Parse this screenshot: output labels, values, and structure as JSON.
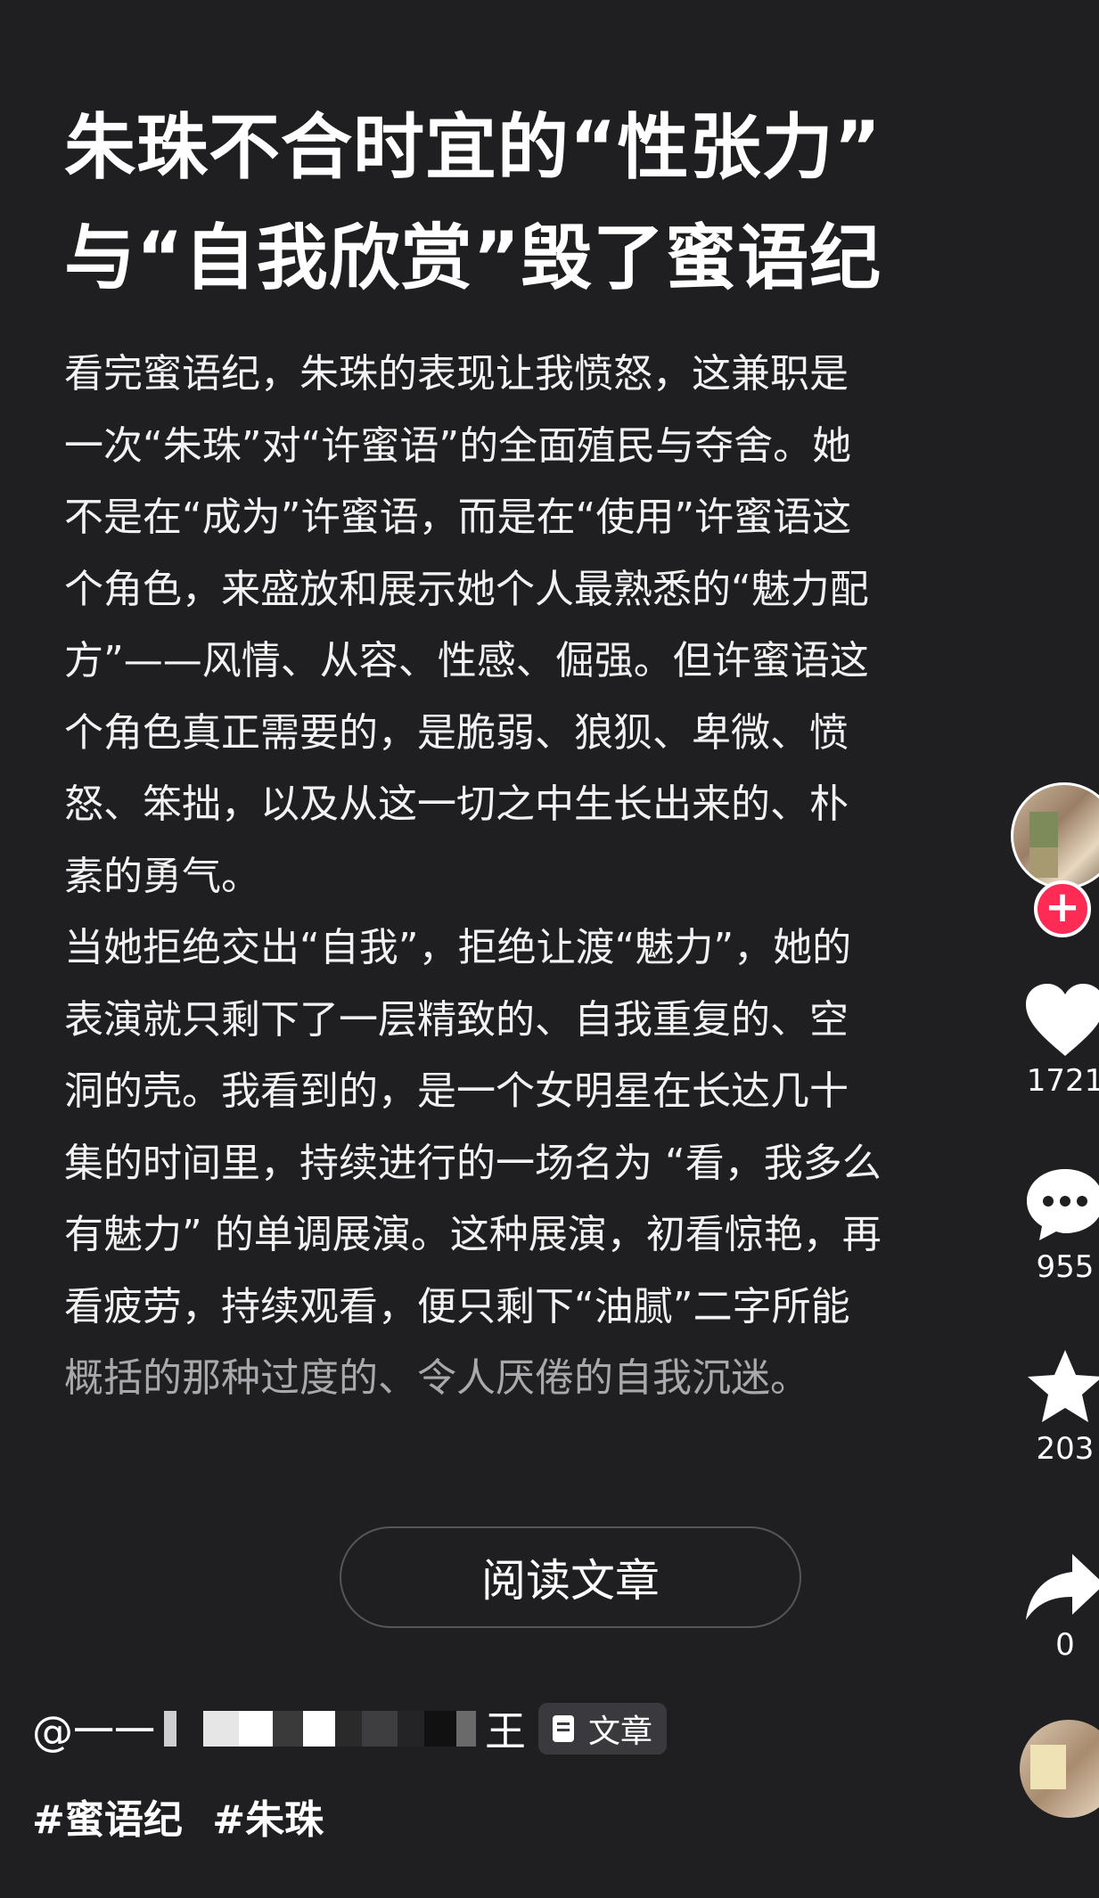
{
  "article": {
    "title_lines": [
      "朱珠不合时宜的“性张力”",
      "与“自我欣赏”毁了蜜语纪"
    ],
    "body_lines": [
      "看完蜜语纪，朱珠的表现让我愤怒，这兼职是",
      "一次“朱珠”对“许蜜语”的全面殖民与夺舍。她",
      "不是在“成为”许蜜语，而是在“使用”许蜜语这",
      "个角色，来盛放和展示她个人最熟悉的“魅力配",
      "方”——风情、从容、性感、倔强。但许蜜语这",
      "个角色真正需要的，是脆弱、狼狈、卑微、愤",
      "怒、笨拙，以及从这一切之中生长出来的、朴",
      "素的勇气。",
      "当她拒绝交出“自我”，拒绝让渡“魅力”，她的",
      "表演就只剩下了一层精致的、自我重复的、空",
      "洞的壳。我看到的，是一个女明星在长达几十",
      "集的时间里，持续进行的一场名为 “看，我多么",
      "有魅力” 的单调展演。这种展演，初看惊艳，再",
      "看疲劳，持续观看，便只剩下“油腻”二字所能",
      "概括的那种过度的、令人厌倦的自我沉迷。"
    ],
    "read_button": "阅读文章"
  },
  "author": {
    "prefix": "@一一",
    "suffix": "王",
    "chip_label": "文章"
  },
  "hashtags": [
    "#蜜语纪",
    "#朱珠"
  ],
  "actions": {
    "like_count": "1721",
    "comment_count": "955",
    "favorite_count": "203",
    "share_count": "0"
  },
  "colors": {
    "background": "#1f1f21",
    "follow_button": "#fe2c55",
    "chip_background": "#3a3a3e"
  }
}
